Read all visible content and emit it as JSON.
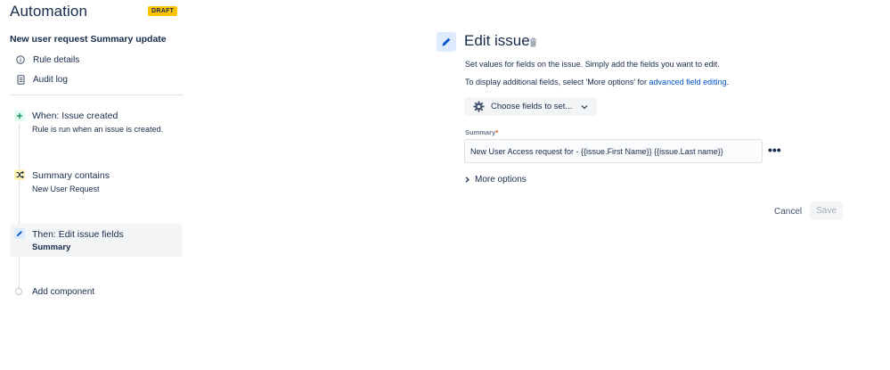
{
  "app": {
    "title": "Automation",
    "badge": "DRAFT"
  },
  "rule": {
    "name": "New user request Summary update"
  },
  "nav": {
    "items": [
      {
        "label": "Rule details",
        "icon": "info-icon"
      },
      {
        "label": "Audit log",
        "icon": "document-icon"
      }
    ]
  },
  "steps": {
    "trigger": {
      "title": "When: Issue created",
      "subtitle": "Rule is run when an issue is created.",
      "icon": "plus-icon"
    },
    "condition": {
      "title": "Summary contains",
      "subtitle": "New User Request",
      "icon": "shuffle-icon"
    },
    "action": {
      "title": "Then: Edit issue fields",
      "subtitle": "Summary",
      "icon": "pencil-icon"
    },
    "add": {
      "title": "Add component"
    }
  },
  "panel": {
    "title": "Edit issue",
    "description1": "Set values for fields on the issue. Simply add the fields you want to edit.",
    "description2_prefix": "To display additional fields, select 'More options' for ",
    "description2_link": "advanced field editing",
    "description2_suffix": ".",
    "choose_fields_label": "Choose fields to set...",
    "field_label": "Summary",
    "field_required_marker": "*",
    "field_value": "New User Access request for - {{issue.First Name}} {{issue.Last name}}",
    "more_dots": "•••",
    "more_options_label": "More options",
    "cancel_label": "Cancel",
    "save_label": "Save"
  },
  "colors": {
    "draft_badge": "#ffc400",
    "link": "#0052cc",
    "trigger_badge_bg": "#e3fcef",
    "condition_badge_bg": "#fff0b3",
    "action_badge_bg": "#deebff",
    "selected_step_bg": "#f4f5f7"
  }
}
